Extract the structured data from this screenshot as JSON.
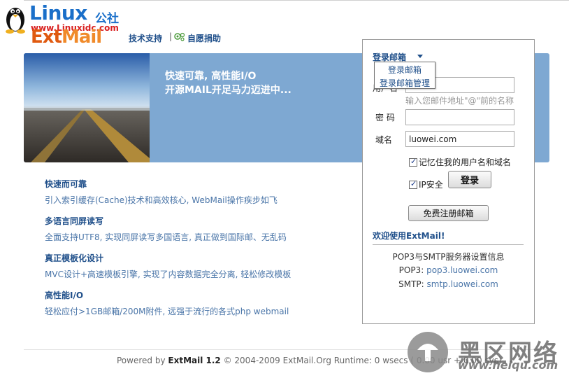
{
  "header": {
    "linux_word": "Linux",
    "linux_cjk": "公社",
    "linux_url": "www.Linuxidc.com",
    "extmail_part1": "Ext",
    "extmail_part2": "Mail",
    "support_link": "技术支持",
    "separator": "|",
    "donate_link": "自愿捐助"
  },
  "banner": {
    "line1": "快速可靠, 高性能I/O",
    "line2": "开源MAIL开足马力迈进中..."
  },
  "features": [
    {
      "title": "快速而可靠",
      "desc": "引入索引缓存(Cache)技术和高效核心, WebMail操作疾步如飞"
    },
    {
      "title": "多语言同屏读写",
      "desc": "全面支持UTF8, 实现同屏读写多国语言, 真正做到国际邮、无乱码"
    },
    {
      "title": "真正模板化设计",
      "desc": "MVC设计+高速模板引擎, 实现了内容数据完全分离, 轻松修改模板"
    },
    {
      "title": "高性能I/O",
      "desc": "轻松应付>1GB邮箱/200M附件, 远强于流行的各式php webmail"
    }
  ],
  "login": {
    "heading": "登录邮箱",
    "username_label": "用户名",
    "username_value": "",
    "username_hint": "输入您邮件地址\"@\"前的名称",
    "password_label": "密 码",
    "password_value": "",
    "domain_label": "域名",
    "domain_value": "luowei.com",
    "remember_label": "记忆住我的用户名和域名",
    "remember_checked": true,
    "ipsecure_label": "IP安全",
    "ipsecure_checked": true,
    "login_button": "登录",
    "register_button": "免费注册邮箱"
  },
  "dropdown": {
    "items": [
      "登录邮箱",
      "登录邮箱管理"
    ]
  },
  "info": {
    "welcome": "欢迎使用ExtMail!",
    "heading": "POP3与SMTP服务器设置信息",
    "pop3_key": "POP3:",
    "pop3_value": "pop3.luowei.com",
    "smtp_key": "SMTP:",
    "smtp_value": "smtp.luowei.com"
  },
  "footer": {
    "prefix": "Powered by",
    "product": "ExtMail 1.2",
    "rest": "© 2004-2009 ExtMail.Org Runtime: 0 wsecs ( 0.00 usr + 0.00 sys)"
  },
  "watermark": {
    "cjk": "黑区网络",
    "url": "www.heiqu.com"
  },
  "colors": {
    "link_blue": "#1f4f8a",
    "banner_blue": "#7ea8d2",
    "desc_blue": "#4a75a8",
    "extmail_orange": "#e05a10"
  }
}
